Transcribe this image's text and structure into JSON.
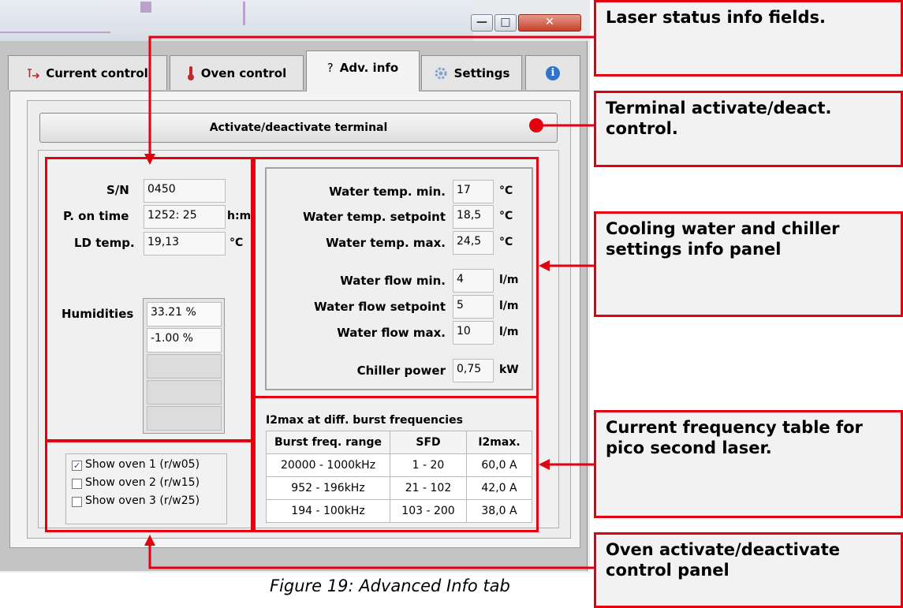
{
  "window": {
    "min_glyph": "—",
    "max_glyph": "□",
    "close_glyph": "✕"
  },
  "tabs": [
    {
      "label": "Current control",
      "icon": "current-icon"
    },
    {
      "label": "Oven control",
      "icon": "thermometer-icon"
    },
    {
      "label": "Adv. info",
      "icon": "question-icon",
      "icon_text": "?"
    },
    {
      "label": "Settings",
      "icon": "gear-icon"
    },
    {
      "label": "",
      "icon": "info-icon",
      "icon_text": "i"
    }
  ],
  "terminal_button": "Activate/deactivate terminal",
  "laser_status": {
    "sn_label": "S/N",
    "sn_value": "0450",
    "pon_label": "P. on time",
    "pon_value": "1252: 25",
    "pon_unit": "h:m",
    "ld_label": "LD temp.",
    "ld_value": "19,13",
    "ld_unit": "°C"
  },
  "humidities": {
    "label": "Humidities",
    "values": [
      "33.21 %",
      "-1.00 %",
      "",
      "",
      ""
    ]
  },
  "cooling": [
    {
      "label": "Water temp. min.",
      "value": "17",
      "unit": "°C"
    },
    {
      "label": "Water temp. setpoint",
      "value": "18,5",
      "unit": "°C"
    },
    {
      "label": "Water temp. max.",
      "value": "24,5",
      "unit": "°C"
    },
    {
      "label": "Water flow min.",
      "value": "4",
      "unit": "l/m"
    },
    {
      "label": "Water flow setpoint",
      "value": "5",
      "unit": "l/m"
    },
    {
      "label": "Water flow max.",
      "value": "10",
      "unit": "l/m"
    },
    {
      "label": "Chiller power",
      "value": "0,75",
      "unit": "kW"
    }
  ],
  "i2max": {
    "title": "I2max at diff. burst frequencies",
    "headers": [
      "Burst freq. range",
      "SFD",
      "I2max."
    ],
    "rows": [
      [
        "20000 - 1000kHz",
        "1 - 20",
        "60,0 A"
      ],
      [
        "952 - 196kHz",
        "21 - 102",
        "42,0 A"
      ],
      [
        "194 - 100kHz",
        "103 - 200",
        "38,0 A"
      ]
    ]
  },
  "ovens": [
    {
      "label": "Show oven 1 (r/w05)",
      "checked": "✓"
    },
    {
      "label": "Show oven 2 (r/w15)",
      "checked": ""
    },
    {
      "label": "Show oven 3 (r/w25)",
      "checked": ""
    }
  ],
  "callouts": {
    "laser_status": "Laser status info fields.",
    "terminal": "Terminal activate/deact. control.",
    "cooling": "Cooling water and chiller settings info panel",
    "frequency": "Current frequency table for pico second laser.",
    "oven": "Oven activate/deactivate control panel"
  },
  "caption": "Figure 19: Advanced Info tab",
  "colors": {
    "annotation_red": "#e4000f",
    "callout_bg": "#f2f2f2",
    "checkbox_blue": "#1a4fa0"
  }
}
